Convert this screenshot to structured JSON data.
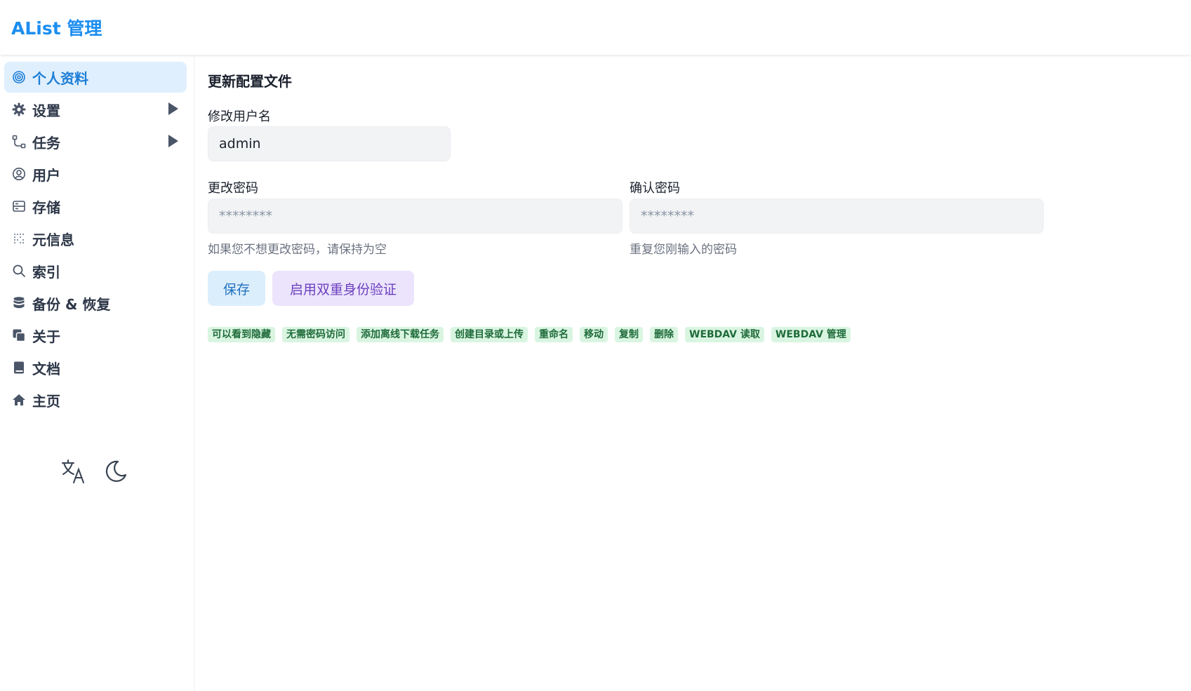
{
  "header": {
    "title": "AList 管理"
  },
  "sidebar": {
    "items": [
      {
        "label": "个人资料",
        "icon": "fingerprint-icon",
        "active": true,
        "has_arrow": false
      },
      {
        "label": "设置",
        "icon": "gear-icon",
        "active": false,
        "has_arrow": true
      },
      {
        "label": "任务",
        "icon": "flow-icon",
        "active": false,
        "has_arrow": true
      },
      {
        "label": "用户",
        "icon": "user-circle-icon",
        "active": false,
        "has_arrow": false
      },
      {
        "label": "存储",
        "icon": "storage-icon",
        "active": false,
        "has_arrow": false
      },
      {
        "label": "元信息",
        "icon": "meta-icon",
        "active": false,
        "has_arrow": false
      },
      {
        "label": "索引",
        "icon": "search-icon",
        "active": false,
        "has_arrow": false
      },
      {
        "label": "备份 & 恢复",
        "icon": "database-icon",
        "active": false,
        "has_arrow": false
      },
      {
        "label": "关于",
        "icon": "copy-icon",
        "active": false,
        "has_arrow": false
      },
      {
        "label": "文档",
        "icon": "book-icon",
        "active": false,
        "has_arrow": false
      },
      {
        "label": "主页",
        "icon": "home-icon",
        "active": false,
        "has_arrow": false
      }
    ],
    "bottom": {
      "translate_icon": "translate-icon",
      "theme_icon": "moon-icon"
    }
  },
  "main": {
    "title": "更新配置文件",
    "username": {
      "label": "修改用户名",
      "value": "admin"
    },
    "password": {
      "label": "更改密码",
      "placeholder": "********",
      "hint": "如果您不想更改密码，请保持为空"
    },
    "confirm": {
      "label": "确认密码",
      "placeholder": "********",
      "hint": "重复您刚输入的密码"
    },
    "buttons": {
      "save": "保存",
      "enable_2fa": "启用双重身份验证"
    },
    "permissions": [
      "可以看到隐藏",
      "无需密码访问",
      "添加离线下载任务",
      "创建目录或上传",
      "重命名",
      "移动",
      "复制",
      "删除",
      "WEBDAV 读取",
      "WEBDAV 管理"
    ]
  },
  "colors": {
    "brand": "#1c8ef0",
    "active_bg": "#e0effd",
    "tag_bg": "#d9f5e1",
    "tag_text": "#1f6b3a"
  }
}
